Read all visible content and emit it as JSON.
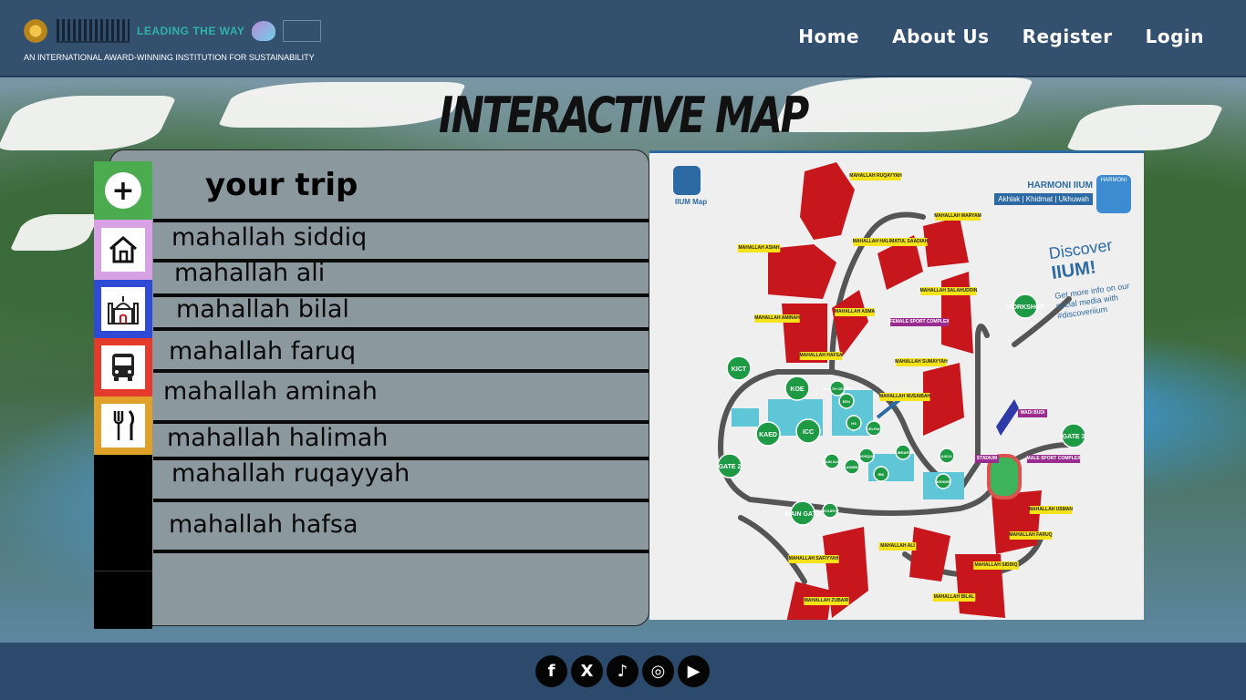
{
  "header": {
    "logo_leading": "LEADING THE WAY",
    "logo_tagline": "AN INTERNATIONAL AWARD-WINNING INSTITUTION FOR SUSTAINABILITY",
    "nav": [
      {
        "label": "Home"
      },
      {
        "label": "About Us"
      },
      {
        "label": "Register"
      },
      {
        "label": "Login"
      }
    ]
  },
  "main": {
    "title": "INTERACTIVE MAP",
    "trip": {
      "title": "your trip",
      "items": [
        {
          "label": "mahallah siddiq"
        },
        {
          "label": "mahallah ali"
        },
        {
          "label": "mahallah bilal"
        },
        {
          "label": "mahallah faruq"
        },
        {
          "label": "mahallah aminah"
        },
        {
          "label": "mahallah halimah"
        },
        {
          "label": "mahallah ruqayyah"
        },
        {
          "label": "mahallah hafsa"
        }
      ]
    },
    "sidebar": [
      {
        "icon": "plus-icon",
        "color": "#4bab4f"
      },
      {
        "icon": "home-icon",
        "color": "#d8a1e4"
      },
      {
        "icon": "mosque-icon",
        "color": "#2f4bd6"
      },
      {
        "icon": "bus-icon",
        "color": "#e43b2d"
      },
      {
        "icon": "fork-knife-icon",
        "color": "#e0a12a"
      }
    ],
    "map": {
      "app_name": "IIUM Map",
      "harmoni_title": "HARMONI IIUM",
      "harmoni_sub": "Akhlak | Khidmat | Ukhuwah",
      "badge_label": "HARMONI",
      "discover_1": "Discover",
      "discover_2": "IIUM!",
      "discover_3": "Get more info on our social media with #discoveriium",
      "green_pins": [
        "KICT",
        "KOE",
        "ICC",
        "KAED",
        "GATE 2",
        "MAIN GATE",
        "GATE 3",
        "WORKSHOP",
        "EDU",
        "HS",
        "CELPAD",
        "IRK",
        "KENMS",
        "AIKOL",
        "LIBRARY",
        "ADMIN",
        "MOSQUE",
        "MAIN AUDI",
        "SECURITY",
        "HEALTH CENTER"
      ],
      "yellow_labels": [
        "MAHALLAH RUQAYYAH",
        "MAHALLAH MARYAM",
        "MAHALLAH ASIAH",
        "MAHALLAH HALIMATUL SAADIAH",
        "MAHALLAH SALAHUDDIN",
        "MAHALLAH AMINAH",
        "MAHALLAH ASMA",
        "MAHALLAH HAFSA",
        "MAHALLAH SUMAYYAH",
        "MAHALLAH NUSAIBAH",
        "MAHALLAH USMAN",
        "MAHALLAH FARUQ",
        "MAHALLAH ALI",
        "MAHALLAH SIDDIQ",
        "MAHALLAH SAFIYYAH",
        "MAHALLAH ZUBAIR",
        "MAHALLAH BILAL"
      ],
      "purple_labels": [
        "FEMALE SPORT COMPLEX",
        "WADI BUDI",
        "STADIUM",
        "MALE SPORT COMPLEX"
      ]
    }
  },
  "footer": {
    "socials": [
      {
        "icon": "facebook-icon",
        "glyph": "f"
      },
      {
        "icon": "x-icon",
        "glyph": "X"
      },
      {
        "icon": "tiktok-icon",
        "glyph": "♪"
      },
      {
        "icon": "instagram-icon",
        "glyph": "◎"
      },
      {
        "icon": "youtube-icon",
        "glyph": "▶"
      }
    ]
  },
  "colors": {
    "header_bg": "#34506f",
    "panel_bg": "#8b999f",
    "map_red": "#c8161d",
    "map_green": "#1e9a44",
    "map_yellow": "#f5e31a",
    "map_cyan": "#5ec6d6"
  }
}
